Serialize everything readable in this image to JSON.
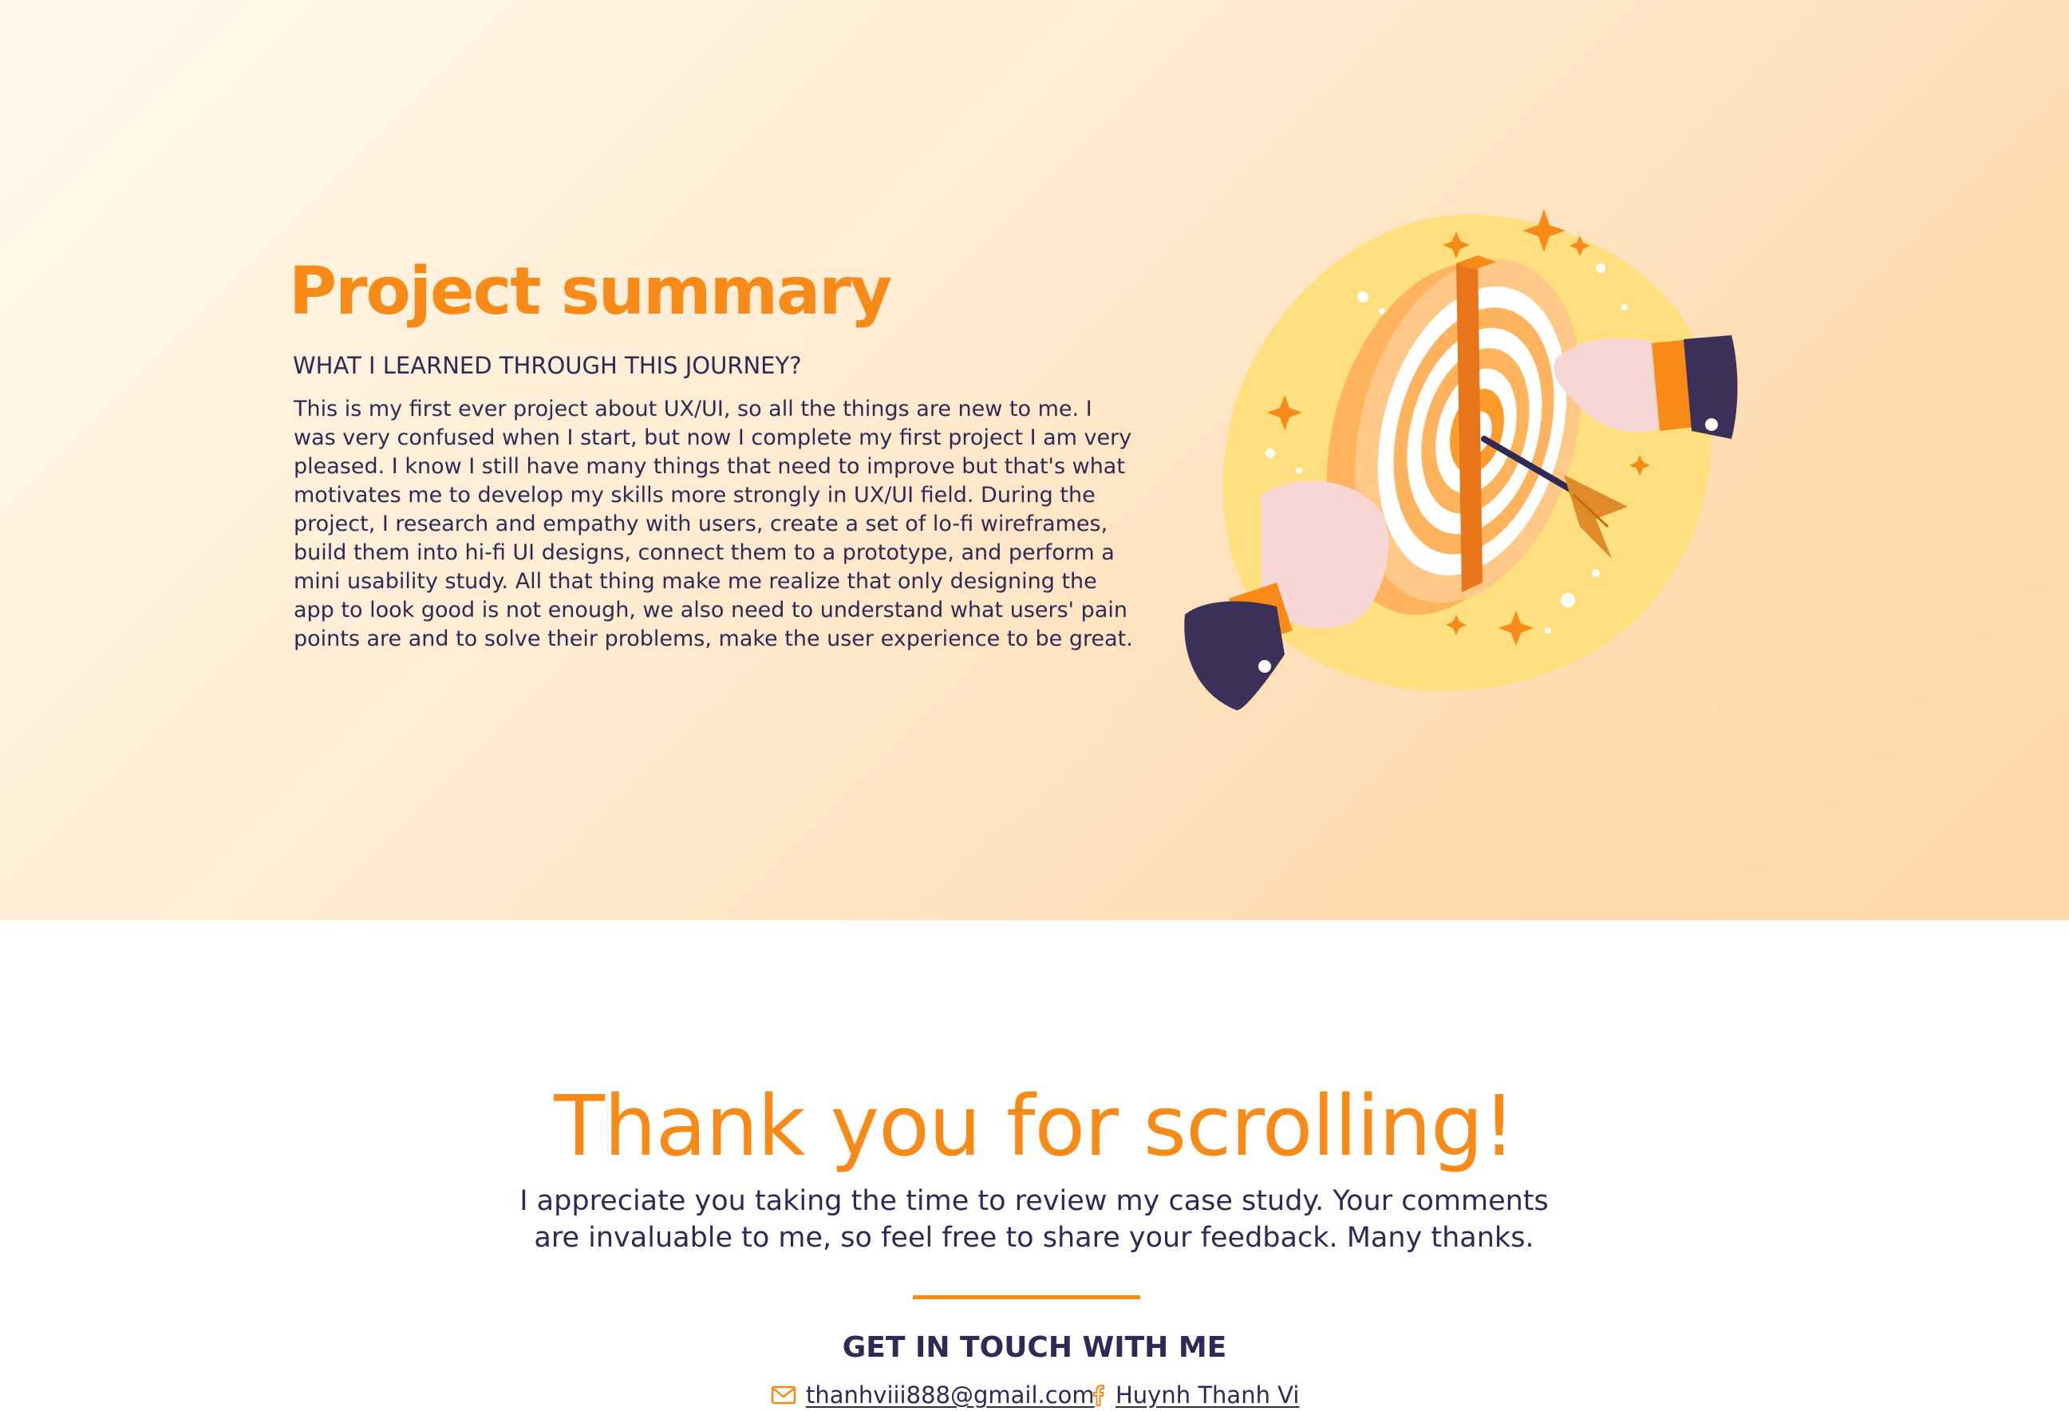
{
  "summary": {
    "title": "Project summary",
    "subtitle": "WHAT I LEARNED THROUGH THIS JOURNEY?",
    "body": "This is my first ever project about UX/UI, so all the things are new to me. I was very confused when I start, but now I complete my first project I am very pleased. I know I still have many things that need to improve but that's what motivates me to develop my skills more strongly in UX/UI field. During the project, I  research and empathy with users, create a set of lo-fi wireframes, build them into hi-fi UI designs, connect them to a prototype, and perform a mini usability study. All that thing make me realize that only designing the app to look good is not enough, we also need to understand what users' pain points are and to solve their problems, make the user experience to be great."
  },
  "thanks": {
    "title": "Thank you for scrolling!",
    "text": "I appreciate you taking the time to review my case study. Your comments are invaluable to me, so feel free to share your feedback. Many thanks."
  },
  "contact": {
    "heading": "GET IN TOUCH WITH ME",
    "email": "thanhviii888@gmail.com",
    "email_icon": "mail-icon",
    "facebook": "Huynh Thanh Vi",
    "facebook_icon": "facebook-icon"
  },
  "colors": {
    "accent": "#f88a17",
    "text": "#2e2a55",
    "section_bg": "#ffe3c0"
  }
}
